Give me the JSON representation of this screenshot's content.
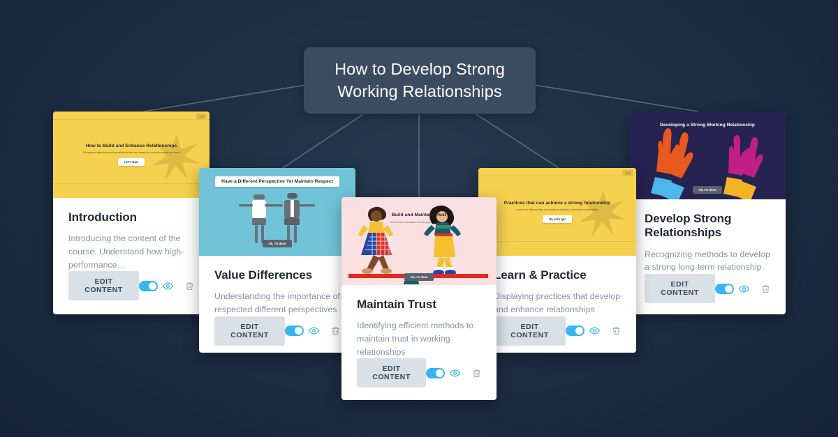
{
  "theme": {
    "background": "#1e2f44",
    "title_pill_bg": "#3b4c61",
    "accent_toggle": "#36b5f0",
    "edit_button_bg": "#d9e0e6",
    "connector_line": "#6d7f94"
  },
  "header": {
    "title": "How to Develop Strong Working Relationships"
  },
  "cards": [
    {
      "id": "introduction",
      "title": "Introduction",
      "description": "Introducing the content of the course. Understand how high-performance…",
      "edit_label": "EDIT CONTENT",
      "toggle_on": true,
      "thumb": {
        "bg": "#f6d14f",
        "title": "How to Build and Enhance Relationships",
        "subtitle": "Strong and effective working relationships are based on mutual respect and trust",
        "button": "Let's start",
        "badge": "1/4"
      }
    },
    {
      "id": "value-differences",
      "title": "Value Differences",
      "description": "Understanding the importance of respected different perspectives",
      "edit_label": "EDIT CONTENT",
      "toggle_on": true,
      "thumb": {
        "bg": "#71c4d8",
        "title": "Have a Different Perspective Yet Maintain Respect",
        "subtitle": "",
        "button": "Ok, I'm done",
        "badge": ""
      }
    },
    {
      "id": "maintain-trust",
      "title": "Maintain Trust",
      "description": "Identifying efficient methods to maintain trust in working relationships",
      "edit_label": "EDIT CONTENT",
      "toggle_on": true,
      "thumb": {
        "bg": "#fbe0e2",
        "title": "Build and Maintain Trust",
        "subtitle": "Trust is the foundation of every good relationship",
        "button": "Ok, I'm done",
        "badge": ""
      }
    },
    {
      "id": "learn-and-practice",
      "title": "Learn & Practice",
      "description": "Displaying practices that develop and enhance relationships",
      "edit_label": "EDIT CONTENT",
      "toggle_on": true,
      "thumb": {
        "bg": "#f6d14f",
        "title": "Practices that can achieve a strong relationship",
        "subtitle": "Learn the different tips and tricks to develop a long-term relationship",
        "button": "Ok, let's go!",
        "badge": "3/4"
      }
    },
    {
      "id": "develop-strong-relationships",
      "title": "Develop Strong Relationships",
      "description": "Recognizing methods to develop a strong long-term relationship",
      "edit_label": "EDIT CONTENT",
      "toggle_on": true,
      "thumb": {
        "bg": "#262350",
        "title": "Developing a Strong Working Relationship",
        "subtitle": "",
        "button": "Ok, I'm done",
        "badge": ""
      }
    }
  ],
  "icons": {
    "eye": "eye-icon",
    "trash": "trash-icon",
    "toggle": "visibility-toggle"
  }
}
